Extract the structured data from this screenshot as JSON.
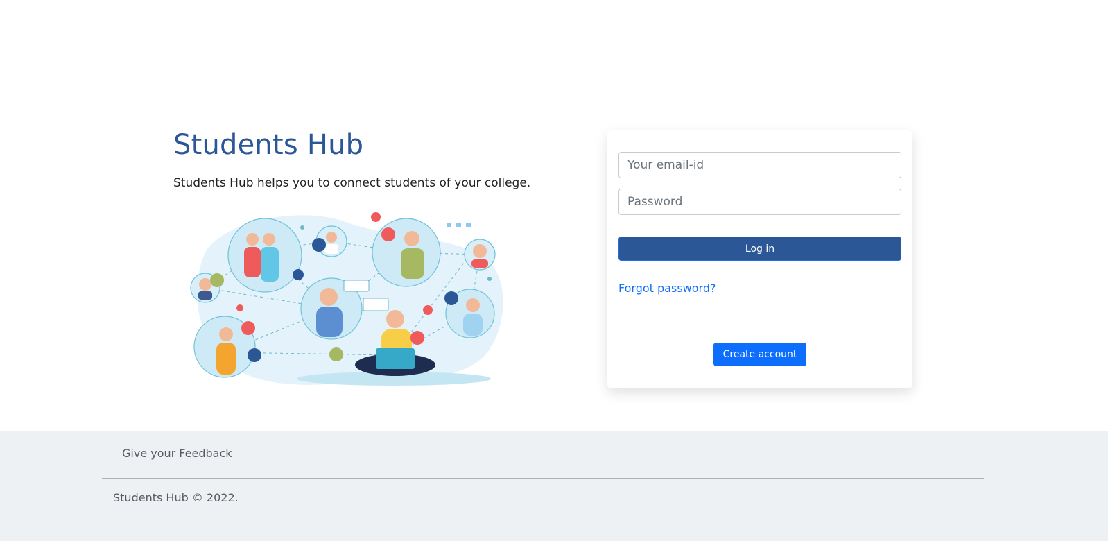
{
  "hero": {
    "title": "Students Hub",
    "subtitle": "Students Hub helps you to connect students of your college."
  },
  "login": {
    "email_placeholder": "Your email-id",
    "password_placeholder": "Password",
    "login_label": "Log in",
    "forgot_label": "Forgot password?",
    "create_label": "Create account"
  },
  "footer": {
    "feedback_label": "Give your Feedback",
    "copyright": "Students Hub © 2022."
  },
  "colors": {
    "brand": "#2b5797",
    "link": "#0d6efd",
    "footer_bg": "#eef1f4"
  },
  "icons": [
    "heart-icon",
    "thumbs-up-icon",
    "share-icon",
    "chat-bubble-icon"
  ]
}
